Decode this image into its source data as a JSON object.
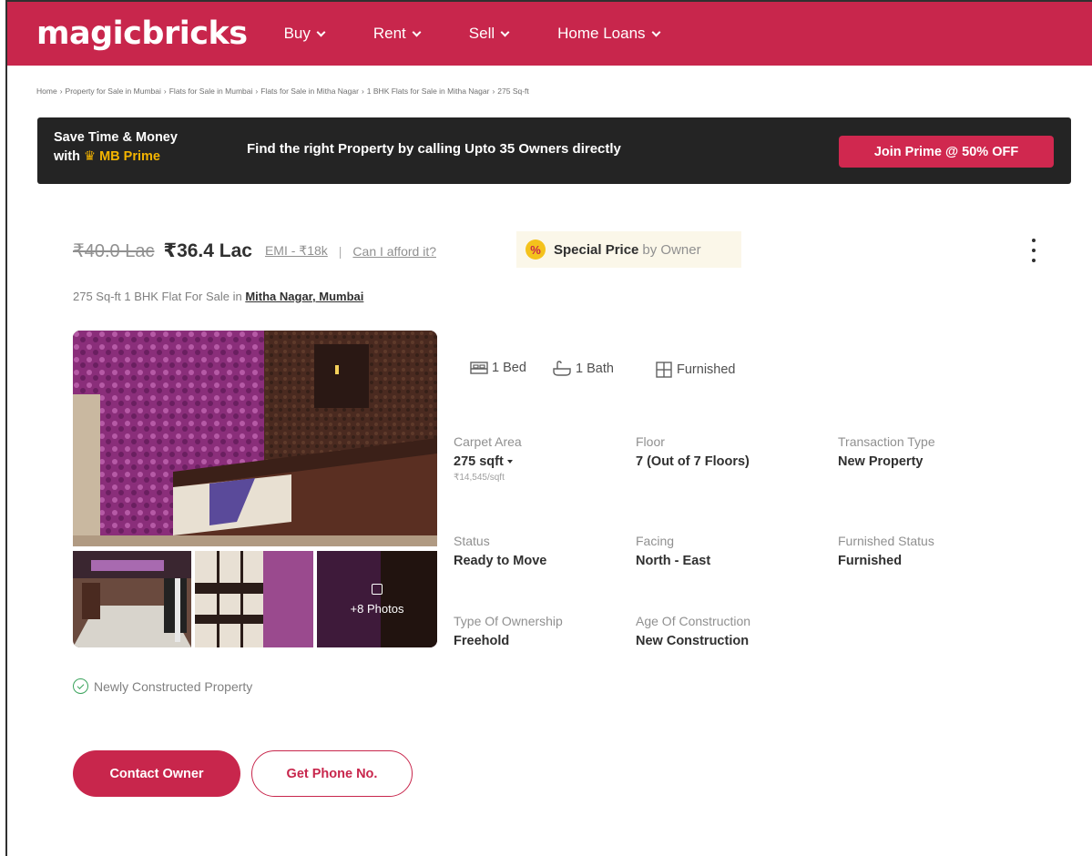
{
  "header": {
    "logo": "magicbricks",
    "nav": [
      {
        "label": "Buy"
      },
      {
        "label": "Rent"
      },
      {
        "label": "Sell"
      },
      {
        "label": "Home Loans"
      }
    ]
  },
  "breadcrumb": [
    "Home",
    "Property for Sale in Mumbai",
    "Flats for Sale in Mumbai",
    "Flats for Sale in Mitha Nagar",
    "1 BHK Flats for Sale in Mitha Nagar",
    "275 Sq-ft"
  ],
  "breadcrumb_sep": "›",
  "banner": {
    "line1": "Save Time & Money",
    "line2_prefix": "with",
    "crown": "♛",
    "line2_brand": "MB Prime",
    "message": "Find the right Property by calling Upto 35 Owners directly",
    "cta": "Join Prime @ 50% OFF"
  },
  "listing": {
    "old_price": "₹40.0 Lac",
    "price": "₹36.4 Lac",
    "emi": "EMI - ₹18k",
    "pipe": "|",
    "afford": "Can I afford it?",
    "special_icon": "%",
    "special_label": "Special Price",
    "special_by": "by Owner",
    "subtitle_prefix": "275 Sq-ft 1 BHK Flat For Sale in",
    "location": "Mitha Nagar, Mumbai",
    "photos_more": "+8 Photos",
    "newly": "Newly Constructed Property",
    "contact_btn": "Contact Owner",
    "phone_btn": "Get Phone No."
  },
  "amenities": {
    "bed": "1 Bed",
    "bath": "1 Bath",
    "furnished": "Furnished"
  },
  "details": {
    "carpet_area": {
      "label": "Carpet Area",
      "value": "275 sqft",
      "sub": "₹14,545/sqft"
    },
    "floor": {
      "label": "Floor",
      "value": "7 (Out of 7 Floors)"
    },
    "transaction": {
      "label": "Transaction Type",
      "value": "New Property"
    },
    "status": {
      "label": "Status",
      "value": "Ready to Move"
    },
    "facing": {
      "label": "Facing",
      "value": "North - East"
    },
    "furnished_status": {
      "label": "Furnished Status",
      "value": "Furnished"
    },
    "ownership": {
      "label": "Type Of Ownership",
      "value": "Freehold"
    },
    "age": {
      "label": "Age Of Construction",
      "value": "New Construction"
    }
  },
  "colors": {
    "brand": "#c8264c",
    "banner_bg": "#242424",
    "prime_gold": "#f4b400",
    "check_green": "#3aa35c"
  },
  "icons": [
    "chevron-down-icon",
    "crown-icon",
    "percent-icon",
    "kebab-menu-icon",
    "bed-icon",
    "bath-icon",
    "furnished-icon",
    "image-icon",
    "check-circle-icon",
    "caret-down-icon"
  ]
}
